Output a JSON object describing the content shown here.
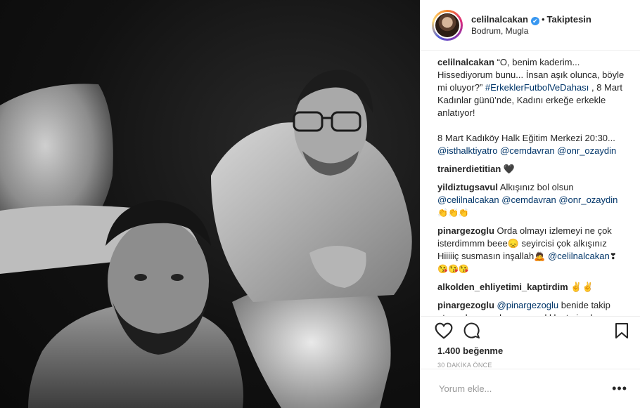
{
  "header": {
    "username": "celilnalcakan",
    "verified_mark": "✔",
    "dot": "•",
    "follow_label": "Takiptesin",
    "location": "Bodrum, Mugla"
  },
  "caption": {
    "user": "celilnalcakan",
    "text1": "“O, benim kaderim... Hissediyorum bunu... İnsan aşık olunca, böyle mi oluyor?”",
    "hashtag": "#ErkeklerFutbolVeDahası",
    "text2": ", 8 Mart Kadınlar günü’nde, Kadını erkeğe erkekle anlatıyor!",
    "text3": "8 Mart Kadıköy Halk Eğitim Merkezi 20:30...",
    "mention1": "@isthalktiyatro",
    "mention2": "@cemdavran",
    "mention3": "@onr_ozaydin"
  },
  "comments": [
    {
      "user": "trainerdietitian",
      "text": "🖤"
    },
    {
      "user": "yildiztugsavul",
      "text": "Alkışınız bol olsun",
      "mentions": "@celilnalcakan @cemdavran @onr_ozaydin",
      "emoji": "👏👏👏"
    },
    {
      "user": "pinargezoglu",
      "text": "Orda olmayı izlemeyi ne çok isterdimmm beee😞 seyircisi çok alkışınız Hiiiiiç susmasın inşallah🙇",
      "mention": "@celilnalcakan",
      "heart": "❣",
      "emoji": "😘😘😘"
    },
    {
      "user": "alkolden_ehliyetimi_kaptirdim",
      "text": "✌✌"
    },
    {
      "user": "pinargezoglu",
      "mention": "@pinargezoglu",
      "text": "benide takip etsen desen çokmu şımarıklık etmiş olurum"
    }
  ],
  "actions": {
    "likes": "1.400 beğenme",
    "time": "30 DAKİKA ÖNCE"
  },
  "add_comment": {
    "placeholder": "Yorum ekle...",
    "more": "•••"
  },
  "icons": {
    "like": "heart-outline-icon",
    "comment": "comment-bubble-icon",
    "save": "bookmark-icon"
  }
}
